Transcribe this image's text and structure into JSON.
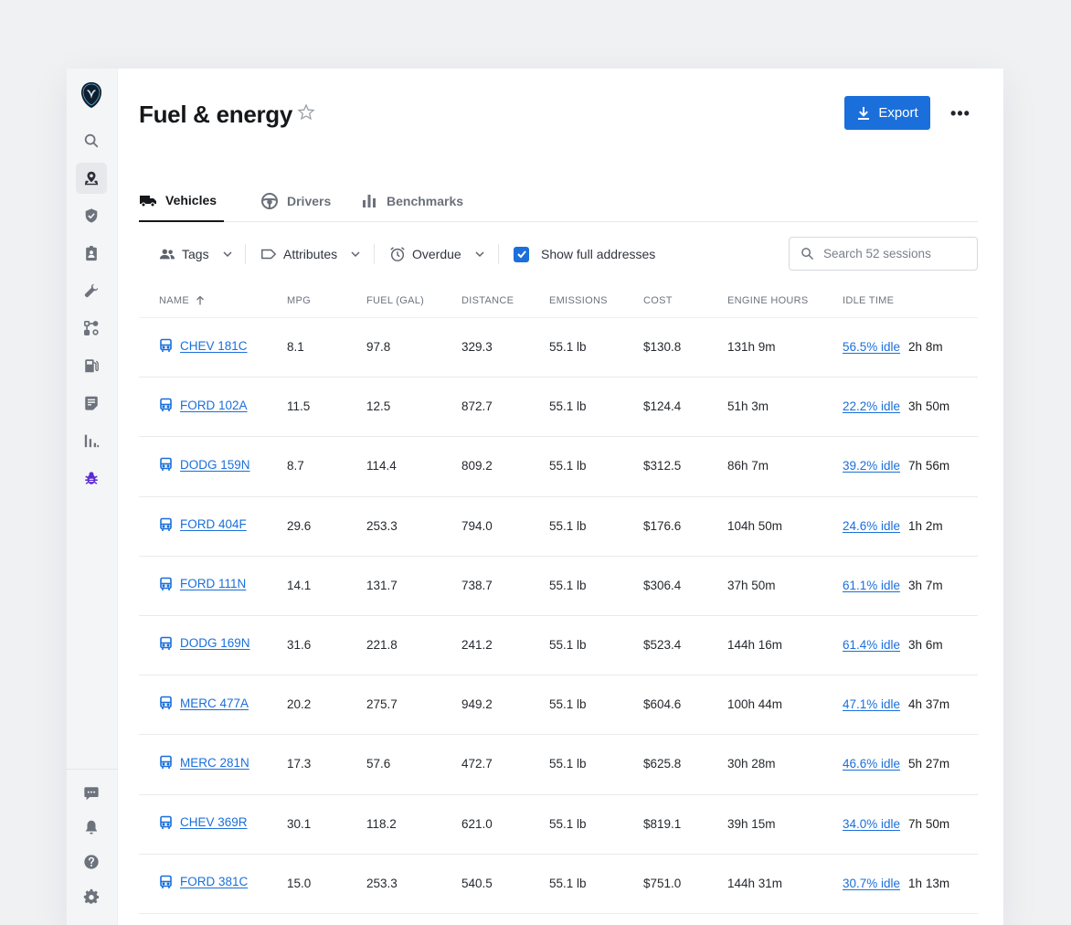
{
  "page": {
    "title": "Fuel & energy",
    "export_label": "Export",
    "more_label": "•••"
  },
  "sidebar": {
    "items": [
      {
        "icon": "search-icon"
      },
      {
        "icon": "map-pin-icon",
        "active": true
      },
      {
        "icon": "shield-icon"
      },
      {
        "icon": "clipboard-user-icon"
      },
      {
        "icon": "wrench-icon"
      },
      {
        "icon": "route-icon"
      },
      {
        "icon": "fuel-pump-icon"
      },
      {
        "icon": "document-icon"
      },
      {
        "icon": "bar-chart-icon"
      },
      {
        "icon": "bug-icon"
      }
    ],
    "bottom_items": [
      {
        "icon": "chat-icon"
      },
      {
        "icon": "bell-icon"
      },
      {
        "icon": "help-icon"
      },
      {
        "icon": "gear-icon"
      }
    ]
  },
  "tabs": [
    {
      "label": "Vehicles",
      "icon": "truck-icon",
      "active": true
    },
    {
      "label": "Drivers",
      "icon": "steering-wheel-icon",
      "active": false
    },
    {
      "label": "Benchmarks",
      "icon": "bar-chart-icon",
      "active": false
    }
  ],
  "filters": {
    "tags": "Tags",
    "attributes": "Attributes",
    "overdue": "Overdue",
    "show_addresses": "Show full addresses",
    "show_addresses_checked": true,
    "search_placeholder": "Search 52 sessions"
  },
  "table": {
    "columns": [
      "NAME",
      "MPG",
      "FUEL (GAL)",
      "DISTANCE",
      "EMISSIONS",
      "COST",
      "ENGINE HOURS",
      "IDLE TIME"
    ],
    "sort_column": "NAME",
    "rows": [
      {
        "name": "CHEV 181C",
        "mpg": "8.1",
        "fuel": "97.8",
        "distance": "329.3",
        "emissions": "55.1 lb",
        "cost": "$130.8",
        "engine_hours": "131h 9m",
        "idle_pct": "56.5% idle",
        "idle_time": "2h 8m"
      },
      {
        "name": "FORD 102A",
        "mpg": "11.5",
        "fuel": "12.5",
        "distance": "872.7",
        "emissions": "55.1 lb",
        "cost": "$124.4",
        "engine_hours": "51h 3m",
        "idle_pct": "22.2% idle",
        "idle_time": "3h 50m"
      },
      {
        "name": "DODG 159N",
        "mpg": "8.7",
        "fuel": "114.4",
        "distance": "809.2",
        "emissions": "55.1 lb",
        "cost": "$312.5",
        "engine_hours": "86h 7m",
        "idle_pct": "39.2% idle",
        "idle_time": "7h 56m"
      },
      {
        "name": "FORD 404F",
        "mpg": "29.6",
        "fuel": "253.3",
        "distance": "794.0",
        "emissions": "55.1 lb",
        "cost": "$176.6",
        "engine_hours": "104h 50m",
        "idle_pct": "24.6% idle",
        "idle_time": "1h 2m"
      },
      {
        "name": "FORD 111N",
        "mpg": "14.1",
        "fuel": "131.7",
        "distance": "738.7",
        "emissions": "55.1 lb",
        "cost": "$306.4",
        "engine_hours": "37h 50m",
        "idle_pct": "61.1% idle",
        "idle_time": "3h 7m"
      },
      {
        "name": "DODG 169N",
        "mpg": "31.6",
        "fuel": "221.8",
        "distance": "241.2",
        "emissions": "55.1 lb",
        "cost": "$523.4",
        "engine_hours": "144h 16m",
        "idle_pct": "61.4% idle",
        "idle_time": "3h 6m"
      },
      {
        "name": "MERC 477A",
        "mpg": "20.2",
        "fuel": "275.7",
        "distance": "949.2",
        "emissions": "55.1 lb",
        "cost": "$604.6",
        "engine_hours": "100h 44m",
        "idle_pct": "47.1% idle",
        "idle_time": "4h 37m"
      },
      {
        "name": "MERC 281N",
        "mpg": "17.3",
        "fuel": "57.6",
        "distance": "472.7",
        "emissions": "55.1 lb",
        "cost": "$625.8",
        "engine_hours": "30h 28m",
        "idle_pct": "46.6% idle",
        "idle_time": "5h 27m"
      },
      {
        "name": "CHEV 369R",
        "mpg": "30.1",
        "fuel": "118.2",
        "distance": "621.0",
        "emissions": "55.1 lb",
        "cost": "$819.1",
        "engine_hours": "39h 15m",
        "idle_pct": "34.0% idle",
        "idle_time": "7h 50m"
      },
      {
        "name": "FORD 381C",
        "mpg": "15.0",
        "fuel": "253.3",
        "distance": "540.5",
        "emissions": "55.1 lb",
        "cost": "$751.0",
        "engine_hours": "144h 31m",
        "idle_pct": "30.7% idle",
        "idle_time": "1h 13m"
      }
    ]
  },
  "colors": {
    "accent": "#1a6fdb",
    "bug_icon": "#5b2bd1"
  }
}
